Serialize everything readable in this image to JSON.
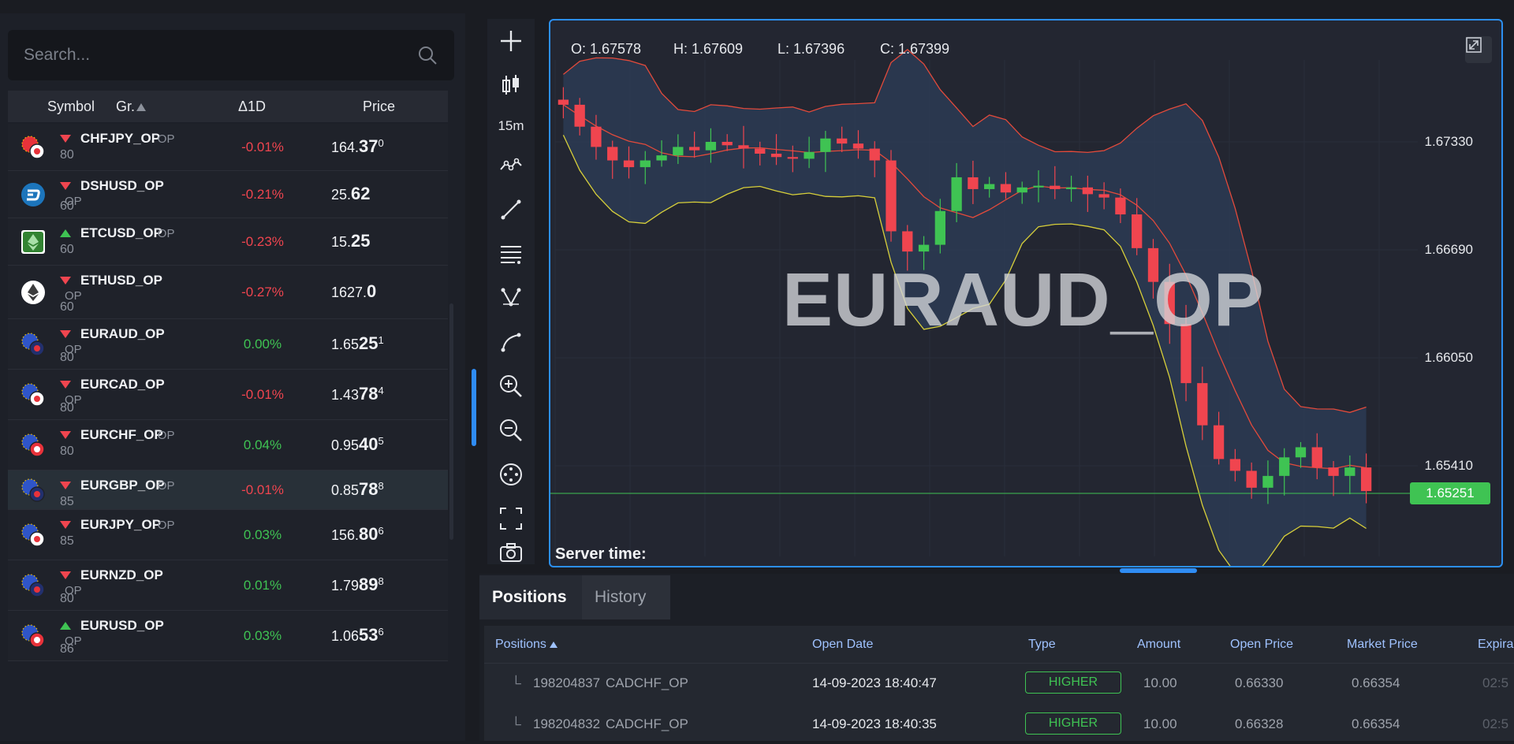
{
  "search": {
    "placeholder": "Search..."
  },
  "table_header": {
    "symbol": "Symbol",
    "group": "Gr.",
    "change": "Δ1D",
    "price": "Price"
  },
  "assets": [
    {
      "symbol": "CHFJPY_OP",
      "op": "OP",
      "op_inline": true,
      "group": "80",
      "dir": "down",
      "change": "-0.01%",
      "change_dir": "neg",
      "price_pre": "164.",
      "price_big": "37",
      "price_sup": "0",
      "icon": "chf-jpy-flag-icon"
    },
    {
      "symbol": "DSHUSD_OP",
      "op": "OP",
      "op_inline": false,
      "group": "60",
      "dir": "down",
      "change": "-0.21%",
      "change_dir": "neg",
      "price_pre": "25.",
      "price_big": "62",
      "price_sup": "",
      "icon": "dash-coin-icon"
    },
    {
      "symbol": "ETCUSD_OP",
      "op": "OP",
      "op_inline": true,
      "group": "60",
      "dir": "up",
      "change": "-0.23%",
      "change_dir": "neg",
      "price_pre": "15.",
      "price_big": "25",
      "price_sup": "",
      "icon": "ethereum-classic-icon"
    },
    {
      "symbol": "ETHUSD_OP",
      "op": "OP",
      "op_inline": false,
      "group": "60",
      "dir": "down",
      "change": "-0.27%",
      "change_dir": "neg",
      "price_pre": "1627.",
      "price_big": "0",
      "price_sup": "",
      "icon": "ethereum-icon"
    },
    {
      "symbol": "EURAUD_OP",
      "op": "OP",
      "op_inline": false,
      "group": "80",
      "dir": "down",
      "change": "0.00%",
      "change_dir": "pos",
      "price_pre": "1.65",
      "price_big": "25",
      "price_sup": "1",
      "icon": "eur-aud-flag-icon"
    },
    {
      "symbol": "EURCAD_OP",
      "op": "OP",
      "op_inline": false,
      "group": "80",
      "dir": "down",
      "change": "-0.01%",
      "change_dir": "neg",
      "price_pre": "1.43",
      "price_big": "78",
      "price_sup": "4",
      "icon": "eur-cad-flag-icon"
    },
    {
      "symbol": "EURCHF_OP",
      "op": "OP",
      "op_inline": true,
      "group": "80",
      "dir": "down",
      "change": "0.04%",
      "change_dir": "pos",
      "price_pre": "0.95",
      "price_big": "40",
      "price_sup": "5",
      "icon": "eur-chf-flag-icon"
    },
    {
      "symbol": "EURGBP_OP",
      "op": "OP",
      "op_inline": true,
      "group": "85",
      "dir": "down",
      "change": "-0.01%",
      "change_dir": "neg",
      "price_pre": "0.85",
      "price_big": "78",
      "price_sup": "8",
      "icon": "eur-gbp-flag-icon",
      "selected": true
    },
    {
      "symbol": "EURJPY_OP",
      "op": "OP",
      "op_inline": true,
      "group": "85",
      "dir": "down",
      "change": "0.03%",
      "change_dir": "pos",
      "price_pre": "156.",
      "price_big": "80",
      "price_sup": "6",
      "icon": "eur-jpy-flag-icon"
    },
    {
      "symbol": "EURNZD_OP",
      "op": "OP",
      "op_inline": false,
      "group": "80",
      "dir": "down",
      "change": "0.01%",
      "change_dir": "pos",
      "price_pre": "1.79",
      "price_big": "89",
      "price_sup": "8",
      "icon": "eur-nzd-flag-icon"
    },
    {
      "symbol": "EURUSD_OP",
      "op": "OP",
      "op_inline": false,
      "group": "86",
      "dir": "up",
      "change": "0.03%",
      "change_dir": "pos",
      "price_pre": "1.06",
      "price_big": "53",
      "price_sup": "6",
      "icon": "eur-usd-flag-icon"
    }
  ],
  "toolbar": {
    "timeframe": "15m"
  },
  "chart": {
    "ohlc": {
      "o": "O: 1.67578",
      "h": "H: 1.67609",
      "l": "L: 1.67396",
      "c": "C: 1.67399"
    },
    "watermark": "EURAUD_OP",
    "y_labels": [
      "1.67330",
      "1.66690",
      "1.66050",
      "1.65410"
    ],
    "current_price": "1.65251",
    "server_time": "Server time:"
  },
  "chart_data": {
    "type": "candlestick",
    "title": "EURAUD_OP",
    "timeframe": "15m",
    "ohlc_readout": {
      "open": 1.67578,
      "high": 1.67609,
      "low": 1.67396,
      "close": 1.67399
    },
    "y_ticks": [
      1.6733,
      1.6669,
      1.6605,
      1.6541
    ],
    "current_price": 1.65251,
    "indicators": [
      "bollinger-bands"
    ],
    "close_approx": [
      1.6755,
      1.6742,
      1.673,
      1.6722,
      1.6718,
      1.6722,
      1.6725,
      1.673,
      1.6728,
      1.6733,
      1.6731,
      1.6729,
      1.6726,
      1.6724,
      1.6723,
      1.6727,
      1.6735,
      1.6732,
      1.6729,
      1.6722,
      1.668,
      1.6668,
      1.6672,
      1.6692,
      1.6712,
      1.6705,
      1.6708,
      1.6703,
      1.6706,
      1.6707,
      1.6705,
      1.6706,
      1.6702,
      1.67,
      1.669,
      1.667,
      1.665,
      1.6625,
      1.659,
      1.6565,
      1.6545,
      1.6538,
      1.6528,
      1.6535,
      1.6546,
      1.6552,
      1.654,
      1.6535,
      1.654,
      1.6526
    ],
    "colors": {
      "up": "#3fc353",
      "down": "#f0454f",
      "band_fill": "#2e3e58",
      "upper_band": "#e24a3b",
      "lower_band": "#d7cf3a"
    }
  },
  "positions": {
    "tabs": [
      "Positions",
      "History"
    ],
    "headers": {
      "positions": "Positions",
      "open_date": "Open Date",
      "type": "Type",
      "amount": "Amount",
      "open_price": "Open Price",
      "market_price": "Market Price",
      "expiration": "Expira"
    },
    "rows": [
      {
        "id": "198204837",
        "symbol": "CADCHF_OP",
        "date": "14-09-2023 18:40:47",
        "type": "HIGHER",
        "amount": "10.00",
        "open_price": "0.66330",
        "market_price": "0.66354",
        "exp": "02:5"
      },
      {
        "id": "198204832",
        "symbol": "CADCHF_OP",
        "date": "14-09-2023 18:40:35",
        "type": "HIGHER",
        "amount": "10.00",
        "open_price": "0.66328",
        "market_price": "0.66354",
        "exp": "02:5"
      }
    ]
  }
}
